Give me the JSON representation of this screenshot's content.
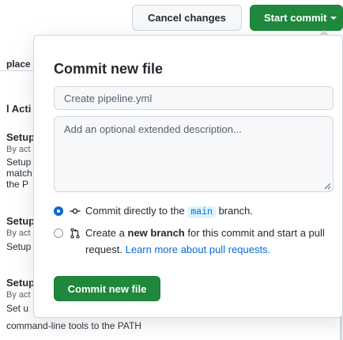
{
  "toolbar": {
    "cancel_label": "Cancel changes",
    "start_commit_label": "Start commit"
  },
  "background": {
    "items": [
      {
        "text": "place",
        "style": "bold-small"
      },
      {
        "text": "l Acti",
        "style": "bold"
      },
      {
        "text": "Setup",
        "style": "bold"
      },
      {
        "text": "By act",
        "style": "muted"
      },
      {
        "text": "Setup",
        "style": "normal"
      },
      {
        "text": "match",
        "style": "normal"
      },
      {
        "text": "the P",
        "style": "normal"
      },
      {
        "text": "Setup",
        "style": "bold"
      },
      {
        "text": "By act",
        "style": "muted"
      },
      {
        "text": "Setup",
        "style": "normal"
      },
      {
        "text": "Setup",
        "style": "bold"
      },
      {
        "text": "By act",
        "style": "muted"
      },
      {
        "text": "Set u",
        "style": "normal"
      }
    ],
    "bottom_line": "command-line tools to the PATH"
  },
  "popup": {
    "title": "Commit new file",
    "summary_placeholder": "Create pipeline.yml",
    "description_placeholder": "Add an optional extended description...",
    "option_direct": {
      "prefix": "Commit directly to the",
      "branch": "main",
      "suffix": "branch.",
      "checked": true
    },
    "option_new_branch": {
      "prefix": "Create a",
      "bold": "new branch",
      "middle": "for this commit and start a pull request.",
      "link": "Learn more about pull requests.",
      "checked": false
    },
    "commit_button_label": "Commit new file"
  },
  "colors": {
    "primary_green": "#1f883d",
    "link_blue": "#0969da",
    "border": "#d0d7de"
  }
}
